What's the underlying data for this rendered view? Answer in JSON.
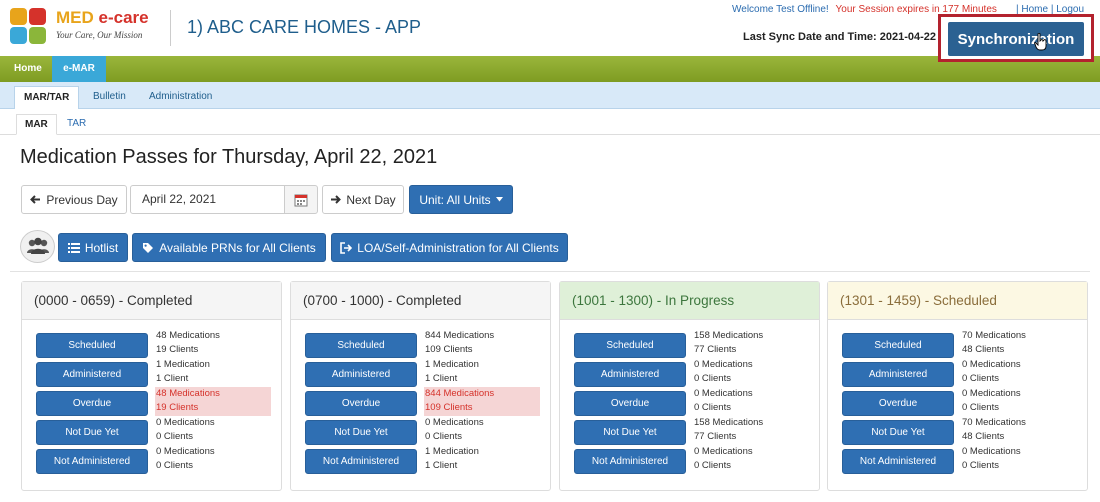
{
  "header": {
    "logo_name_a": "MED ",
    "logo_name_b": "e-care",
    "logo_tagline": "Your Care, Our Mission",
    "app_title": "1) ABC CARE HOMES - APP",
    "welcome": "Welcome Test Offline!",
    "session": "Your Session expires in 177 Minutes",
    "links": "| Home | Logou",
    "last_sync": "Last Sync Date and Time: 2021-04-22 10:27",
    "sync_button": "Synchronization",
    "colors": {
      "title": "#1f5e8c",
      "sync_btn": "#2b6192",
      "highlight_box": "#b3222e"
    }
  },
  "nav": {
    "home": "Home",
    "emar": "e-MAR"
  },
  "subnav": {
    "tabs": [
      "MAR/TAR",
      "Bulletin",
      "Administration"
    ]
  },
  "tabs": [
    "MAR",
    "TAR"
  ],
  "page": {
    "title": "Medication Passes for Thursday, April 22, 2021",
    "prev_day": "Previous Day",
    "date_value": "April 22, 2021",
    "next_day": "Next Day",
    "unit": "Unit: All Units",
    "hotlist": "Hotlist",
    "available_prns": "Available PRNs for All Clients",
    "loa": "LOA/Self-Administration for All Clients"
  },
  "panels": [
    {
      "title": "(0000 - 0659) - Completed",
      "rows": [
        {
          "label": "Scheduled",
          "meds": "48 Medications",
          "clients": "19 Clients"
        },
        {
          "label": "Administered",
          "meds": "1 Medication",
          "clients": "1 Client"
        },
        {
          "label": "Overdue",
          "meds": "48 Medications",
          "clients": "19 Clients"
        },
        {
          "label": "Not Due Yet",
          "meds": "0 Medications",
          "clients": "0 Clients"
        },
        {
          "label": "Not Administered",
          "meds": "0 Medications",
          "clients": "0 Clients"
        }
      ]
    },
    {
      "title": "(0700 - 1000) - Completed",
      "rows": [
        {
          "label": "Scheduled",
          "meds": "844 Medications",
          "clients": "109 Clients"
        },
        {
          "label": "Administered",
          "meds": "1 Medication",
          "clients": "1 Client"
        },
        {
          "label": "Overdue",
          "meds": "844 Medications",
          "clients": "109 Clients"
        },
        {
          "label": "Not Due Yet",
          "meds": "0 Medications",
          "clients": "0 Clients"
        },
        {
          "label": "Not Administered",
          "meds": "1 Medication",
          "clients": "1 Client"
        }
      ]
    },
    {
      "title": "(1001 - 1300) - In Progress",
      "rows": [
        {
          "label": "Scheduled",
          "meds": "158 Medications",
          "clients": "77 Clients"
        },
        {
          "label": "Administered",
          "meds": "0 Medications",
          "clients": "0 Clients"
        },
        {
          "label": "Overdue",
          "meds": "0 Medications",
          "clients": "0 Clients"
        },
        {
          "label": "Not Due Yet",
          "meds": "158 Medications",
          "clients": "77 Clients"
        },
        {
          "label": "Not Administered",
          "meds": "0 Medications",
          "clients": "0 Clients"
        }
      ]
    },
    {
      "title": "(1301 - 1459) - Scheduled",
      "rows": [
        {
          "label": "Scheduled",
          "meds": "70 Medications",
          "clients": "48 Clients"
        },
        {
          "label": "Administered",
          "meds": "0 Medications",
          "clients": "0 Clients"
        },
        {
          "label": "Overdue",
          "meds": "0 Medications",
          "clients": "0 Clients"
        },
        {
          "label": "Not Due Yet",
          "meds": "70 Medications",
          "clients": "48 Clients"
        },
        {
          "label": "Not Administered",
          "meds": "0 Medications",
          "clients": "0 Clients"
        }
      ]
    }
  ]
}
